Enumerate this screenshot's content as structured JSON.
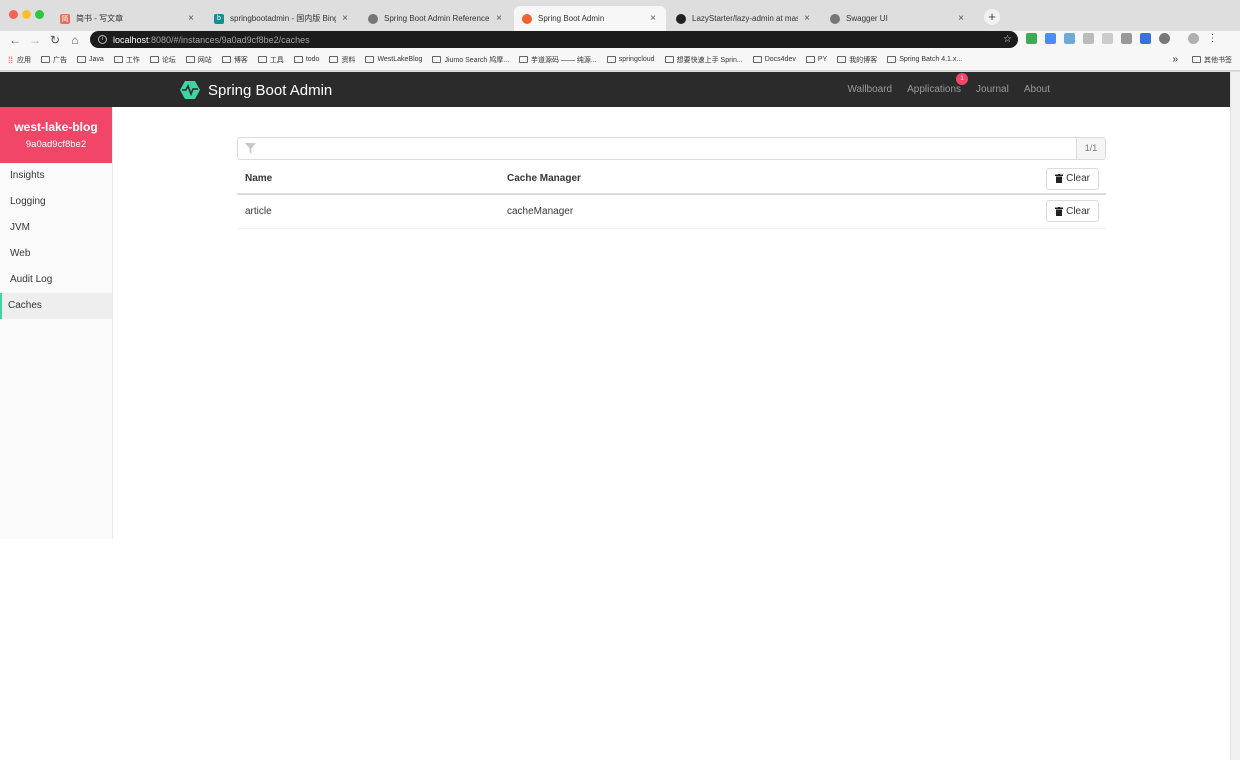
{
  "browser": {
    "tabs": [
      {
        "label": "简书 - 写文章",
        "favicon_color": "#ea6f5a",
        "favicon_glyph": "简"
      },
      {
        "label": "springbootadmin - 国内版 Bing",
        "favicon_color": "#138f8f",
        "favicon_glyph": "b"
      },
      {
        "label": "Spring Boot Admin Reference Gu",
        "favicon_color": "#777777",
        "favicon_glyph": ""
      },
      {
        "label": "Spring Boot Admin",
        "favicon_color": "#f0622e",
        "favicon_glyph": ""
      },
      {
        "label": "LazyStarter/lazy-admin at maste",
        "favicon_color": "#222222",
        "favicon_glyph": ""
      },
      {
        "label": "Swagger UI",
        "favicon_color": "#777777",
        "favicon_glyph": ""
      }
    ],
    "active_tab_index": 3,
    "url_host": "localhost",
    "url_path": ":8080/#/instances/9a0ad9cf8be2/caches",
    "bookmarks": [
      "应用",
      "广告",
      "Java",
      "工作",
      "论坛",
      "网站",
      "博客",
      "工具",
      "todo",
      "资料",
      "WestLakeBlog",
      "Jiumo Search 鸠摩...",
      "芋道源码 —— 纯源...",
      "springcloud",
      "想要快速上手 Sprin...",
      "Docs4dev",
      "PY",
      "我的博客",
      "Spring Batch 4.1.x..."
    ],
    "bookmarks_more": "»",
    "other_bookmarks": "其他书签",
    "new_tab_label": "+",
    "close_glyph": "×"
  },
  "app": {
    "brand": "Spring Boot Admin",
    "brand_color": "#42d3a5",
    "nav": {
      "wallboard": "Wallboard",
      "applications": "Applications",
      "applications_badge": "1",
      "journal": "Journal",
      "about": "About"
    },
    "instance": {
      "name": "west-lake-blog",
      "id": "9a0ad9cf8be2",
      "header_color": "#f14668"
    },
    "sidebar": [
      "Insights",
      "Logging",
      "JVM",
      "Web",
      "Audit Log",
      "Caches"
    ],
    "active_sidebar": "Caches",
    "filter": {
      "placeholder": "",
      "count": "1/1"
    },
    "table": {
      "headers": {
        "name": "Name",
        "cache_manager": "Cache Manager"
      },
      "clear_all_label": "Clear",
      "rows": [
        {
          "name": "article",
          "cache_manager": "cacheManager",
          "action": "Clear"
        }
      ]
    }
  }
}
